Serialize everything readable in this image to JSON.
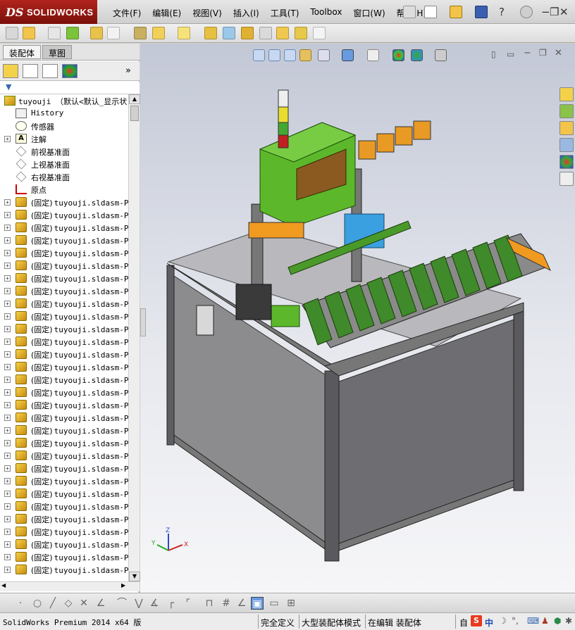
{
  "app": {
    "logo_ds": "DS",
    "logo_name": "SOLIDWORKS"
  },
  "menu": [
    "文件(F)",
    "编辑(E)",
    "视图(V)",
    "插入(I)",
    "工具(T)",
    "Toolbox",
    "窗口(W)",
    "帮助(H)"
  ],
  "window_controls": {
    "help": "?",
    "minimize": "−",
    "restore": "❐",
    "close": "✕"
  },
  "tabs": [
    {
      "label": "装配体",
      "active": false
    },
    {
      "label": "草图",
      "active": true
    }
  ],
  "filter_icon": "filter-icon",
  "tree": {
    "root": "tuyouji （默认<默认_显示状",
    "items": [
      {
        "label": "History",
        "icon": "history-icon",
        "expandable": false
      },
      {
        "label": "传感器",
        "icon": "sensor-icon",
        "expandable": false
      },
      {
        "label": "注解",
        "icon": "annotation-icon",
        "expandable": true
      },
      {
        "label": "前视基准面",
        "icon": "plane-icon",
        "expandable": false
      },
      {
        "label": "上视基准面",
        "icon": "plane-icon",
        "expandable": false
      },
      {
        "label": "右视基准面",
        "icon": "plane-icon",
        "expandable": false
      },
      {
        "label": "原点",
        "icon": "origin-icon",
        "expandable": false
      }
    ],
    "component_prefix": "(固定)",
    "component_name": "tuyouji.sldasm-P",
    "last_component_name": "tuyouji.sldasm-P"
  },
  "status": {
    "product": "SolidWorks Premium 2014 x64 版",
    "fully_defined": "完全定义",
    "large_assembly": "大型装配体模式",
    "editing": "在编辑 装配体",
    "self": "自",
    "ime": "中"
  },
  "colors": {
    "title_red": "#b0241c",
    "machine_green": "#5cb82a",
    "frame_gray": "#6e6e6e",
    "accent_orange": "#f09a20",
    "conveyor_blue": "#3aa0e0"
  }
}
